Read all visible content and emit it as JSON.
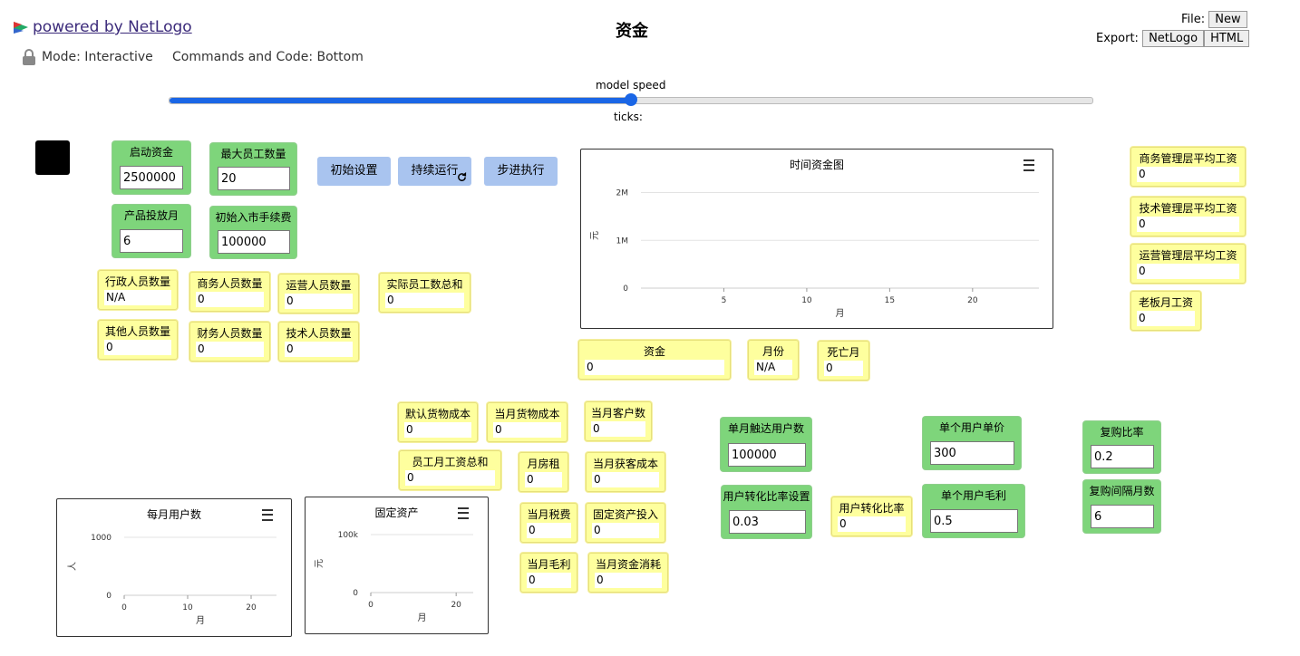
{
  "header": {
    "powered_by": "powered by NetLogo",
    "title": "资金",
    "mode": "Mode: Interactive",
    "commands_and_code": "Commands and Code: Bottom",
    "file_label": "File:",
    "file_new": "New",
    "export_label": "Export:",
    "export_netlogo": "NetLogo",
    "export_html": "HTML"
  },
  "speed": {
    "label": "model speed",
    "ticks_label": "ticks:",
    "value_fraction": 0.5
  },
  "buttons": {
    "setup": "初始设置",
    "go_forever": "持续运行",
    "go_once": "步进执行"
  },
  "inputs": {
    "start_funds": {
      "label": "启动资金",
      "value": "2500000"
    },
    "max_staff": {
      "label": "最大员工数量",
      "value": "20"
    },
    "launch_month": {
      "label": "产品投放月",
      "value": "6"
    },
    "entry_fee": {
      "label": "初始入市手续费",
      "value": "100000"
    },
    "monthly_reach": {
      "label": "单月触达用户数",
      "value": "100000"
    },
    "conversion_setting": {
      "label": "用户转化比率设置",
      "value": "0.03"
    },
    "unit_price": {
      "label": "单个用户单价",
      "value": "300"
    },
    "gross_margin": {
      "label": "单个用户毛利",
      "value": "0.5"
    },
    "repurchase_rate": {
      "label": "复购比率",
      "value": "0.2"
    },
    "repurchase_interval": {
      "label": "复购间隔月数",
      "value": "6"
    }
  },
  "monitors": {
    "admin_staff": {
      "label": "行政人员数量",
      "value": "N/A"
    },
    "biz_staff": {
      "label": "商务人员数量",
      "value": "0"
    },
    "ops_staff": {
      "label": "运营人员数量",
      "value": "0"
    },
    "actual_staff": {
      "label": "实际员工数总和",
      "value": "0"
    },
    "other_staff": {
      "label": "其他人员数量",
      "value": "0"
    },
    "fin_staff": {
      "label": "财务人员数量",
      "value": "0"
    },
    "tech_staff": {
      "label": "技术人员数量",
      "value": "0"
    },
    "funds": {
      "label": "资金",
      "value": "0"
    },
    "month": {
      "label": "月份",
      "value": "N/A"
    },
    "death_month": {
      "label": "死亡月",
      "value": "0"
    },
    "default_goods_cost": {
      "label": "默认货物成本",
      "value": "0"
    },
    "month_goods_cost": {
      "label": "当月货物成本",
      "value": "0"
    },
    "month_customers": {
      "label": "当月客户数",
      "value": "0"
    },
    "salary_total": {
      "label": "员工月工资总和",
      "value": "0"
    },
    "rent": {
      "label": "月房租",
      "value": "0"
    },
    "acq_cost": {
      "label": "当月获客成本",
      "value": "0"
    },
    "tax": {
      "label": "当月税费",
      "value": "0"
    },
    "fixed_invest": {
      "label": "固定资产投入",
      "value": "0"
    },
    "month_gross": {
      "label": "当月毛利",
      "value": "0"
    },
    "month_burn": {
      "label": "当月资金消耗",
      "value": "0"
    },
    "conversion_rate": {
      "label": "用户转化比率",
      "value": "0"
    },
    "biz_mgr_salary": {
      "label": "商务管理层平均工资",
      "value": "0"
    },
    "tech_mgr_salary": {
      "label": "技术管理层平均工资",
      "value": "0"
    },
    "ops_mgr_salary": {
      "label": "运营管理层平均工资",
      "value": "0"
    },
    "boss_salary": {
      "label": "老板月工资",
      "value": "0"
    }
  },
  "chart_data": [
    {
      "type": "line",
      "title": "时间资金图",
      "xlabel": "月",
      "ylabel": "元",
      "x_ticks": [
        "5",
        "10",
        "15",
        "20"
      ],
      "y_ticks": [
        "0",
        "1M",
        "2M"
      ],
      "xlim": [
        0,
        24
      ],
      "ylim": [
        0,
        2200000
      ],
      "series": []
    },
    {
      "type": "line",
      "title": "每月用户数",
      "xlabel": "月",
      "ylabel": "人",
      "x_ticks": [
        "0",
        "10",
        "20"
      ],
      "y_ticks": [
        "0",
        "1000"
      ],
      "xlim": [
        0,
        24
      ],
      "ylim": [
        0,
        1000
      ],
      "series": []
    },
    {
      "type": "line",
      "title": "固定资产",
      "xlabel": "月",
      "ylabel": "元",
      "x_ticks": [
        "0",
        "20"
      ],
      "y_ticks": [
        "0",
        "100k"
      ],
      "xlim": [
        0,
        24
      ],
      "ylim": [
        0,
        100000
      ],
      "series": []
    }
  ]
}
